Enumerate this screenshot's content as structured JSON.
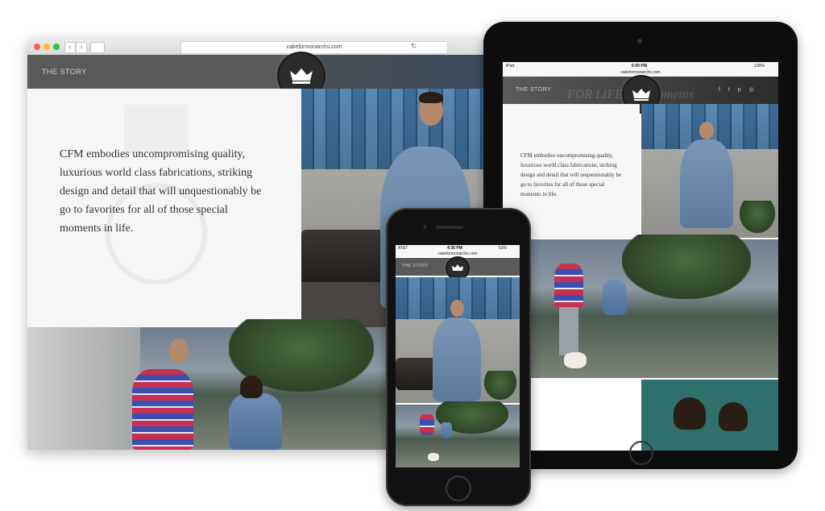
{
  "desktop": {
    "url": "cakeformonarchs.com",
    "nav_label": "THE STORY",
    "quote": "CFM embodies uncompromising quality, luxurious world class fabrications, striking design and detail that will unquestionably be go to favorites for all of those special moments in life.",
    "nav_back": "‹",
    "nav_forward": "›",
    "reload": "↻"
  },
  "ipad": {
    "status_left": "iPad",
    "status_time": "5:00 PM",
    "status_battery": "100%",
    "url": "cakeformonarchs.com",
    "nav_label": "THE STORY",
    "hero_text": "FOR LIFE'S ... moments",
    "quote": "CFM embodies uncompromising quality, luxurious world class fabrications, striking design and detail that will unquestionably be go to favorites for all of those special moments in life.",
    "social": [
      "f",
      "t",
      "p",
      "◎"
    ]
  },
  "iphone": {
    "carrier": "AT&T",
    "time": "4:35 PM",
    "battery": "53%",
    "url": "cakeformonarchs.com",
    "nav_label": "THE STORY"
  },
  "colors": {
    "header_gray": "#5a5a5a",
    "badge_dark": "#2b2b2b",
    "device_black": "#0d0d0d"
  },
  "icons": {
    "crown": "crown-icon",
    "back": "chevron-left-icon",
    "forward": "chevron-right-icon",
    "sidebar": "sidebar-icon",
    "reload": "reload-icon"
  }
}
